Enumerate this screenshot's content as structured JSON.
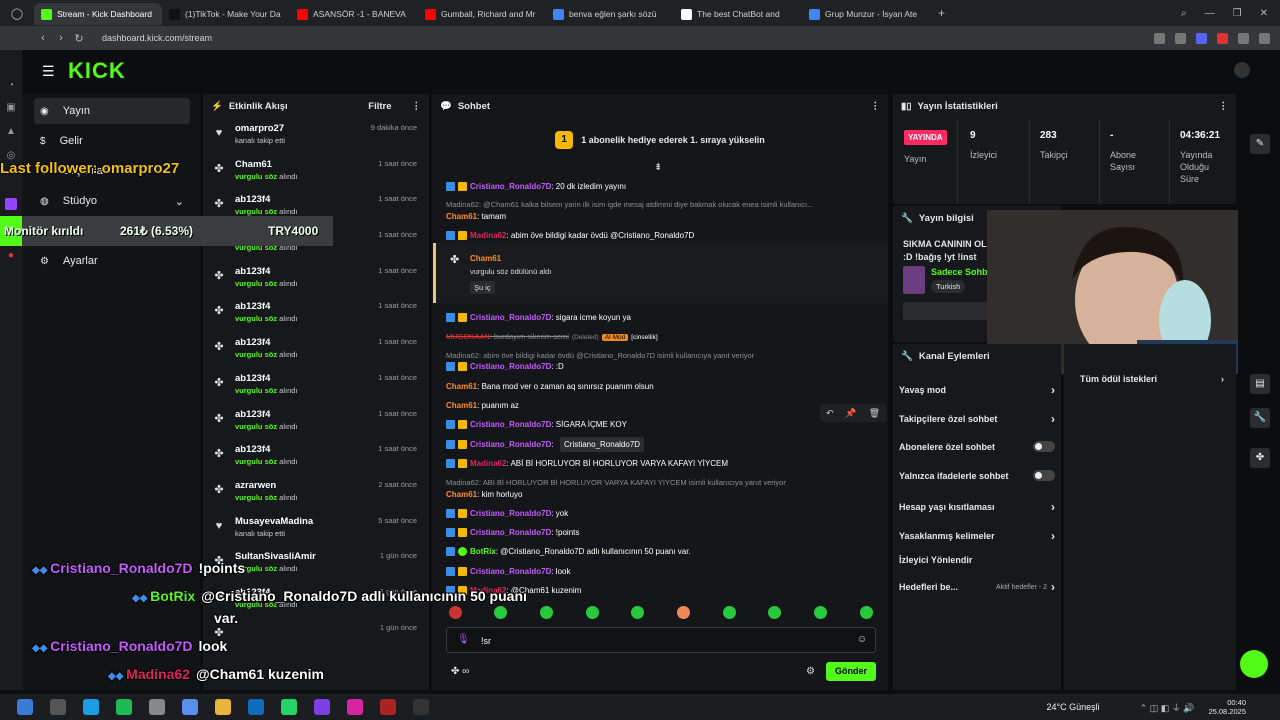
{
  "browser": {
    "tabs": [
      {
        "label": "Stream - Kick Dashboard",
        "color": "#53fc18"
      },
      {
        "label": "(1)TikTok - Make Your Da",
        "color": "#111111"
      },
      {
        "label": "ASANSÖR -1 - BANEVA",
        "color": "#ff0000"
      },
      {
        "label": "Gumball, Richard and Mr",
        "color": "#ff0000"
      },
      {
        "label": "benva eğlen şarkı sözü",
        "color": "#4285f4"
      },
      {
        "label": "The best ChatBot and",
        "color": "#ffffff"
      },
      {
        "label": "Grup Munzur - İsyan Ate",
        "color": "#4285f4"
      }
    ],
    "url": "dashboard.kick.com/stream"
  },
  "logo": "KICK",
  "sidenav": {
    "items": [
      {
        "label": "Yayın",
        "icon": "broadcast-icon"
      },
      {
        "label": "Gelir",
        "icon": "revenue-icon"
      },
      {
        "label": "Başarılar",
        "icon": "trophy-icon"
      },
      {
        "label": "Stüdyo",
        "icon": "studio-icon"
      },
      {
        "label": "Kanal",
        "icon": "channel-icon"
      },
      {
        "label": "Ayarlar",
        "icon": "settings-icon"
      }
    ]
  },
  "activity": {
    "title": "Etkinlik Akışı",
    "filter": "Filtre",
    "items": [
      {
        "name": "omarpro27",
        "sub": "kanalı takip etti",
        "time": "9 dakika önce",
        "icon": "heart-icon"
      },
      {
        "name": "Cham61",
        "sub": "vurgulu söz alındı",
        "time": "1 saat önce",
        "icon": "points-icon"
      },
      {
        "name": "ab123f4",
        "sub": "vurgulu söz alındı",
        "time": "1 saat önce",
        "icon": "points-icon"
      },
      {
        "name": "ab123f4",
        "sub": "vurgulu söz alındı",
        "time": "1 saat önce",
        "icon": "points-icon"
      },
      {
        "name": "ab123f4",
        "sub": "vurgulu söz alındı",
        "time": "1 saat önce",
        "icon": "points-icon"
      },
      {
        "name": "ab123f4",
        "sub": "vurgulu söz alındı",
        "time": "1 saat önce",
        "icon": "points-icon"
      },
      {
        "name": "ab123f4",
        "sub": "vurgulu söz alındı",
        "time": "1 saat önce",
        "icon": "points-icon"
      },
      {
        "name": "ab123f4",
        "sub": "vurgulu söz alındı",
        "time": "1 saat önce",
        "icon": "points-icon"
      },
      {
        "name": "ab123f4",
        "sub": "vurgulu söz alındı",
        "time": "1 saat önce",
        "icon": "points-icon"
      },
      {
        "name": "ab123f4",
        "sub": "vurgulu söz alındı",
        "time": "1 saat önce",
        "icon": "points-icon"
      },
      {
        "name": "azrarwen",
        "sub": "vurgulu söz alındı",
        "time": "2 saat önce",
        "icon": "points-icon"
      },
      {
        "name": "MusayevaMadina",
        "sub": "kanalı takip etti",
        "time": "5 saat önce",
        "icon": "heart-icon"
      },
      {
        "name": "SultanSivasliAmir",
        "sub": "vurgulu söz alındı",
        "time": "1 gün önce",
        "icon": "points-icon"
      },
      {
        "name": "ab123f4",
        "sub": "vurgulu söz alındı",
        "time": "1 gün önce",
        "icon": "points-icon"
      },
      {
        "name": "",
        "sub": "",
        "time": "1 gün önce",
        "icon": "points-icon"
      }
    ]
  },
  "chat": {
    "title": "Sohbet",
    "banner": "1 abonelik hediye ederek 1. sıraya yükselin",
    "banner_num": "1",
    "messages": [
      {
        "kind": "msg",
        "user": "Cristiano_Ronaldo7D",
        "color": "#c65cff",
        "badges": 2,
        "text": ": 20 dk izledim yayını"
      },
      {
        "kind": "reply",
        "text": "Madina62: @Cham61 kalka bilsem yarin ilk isim igde mesaj atdimmi diye bakmak olucak enea isimli kullanıcı..."
      },
      {
        "kind": "msg",
        "user": "Cham61",
        "color": "#ff8c2a",
        "badges": 0,
        "text": ": tamam"
      },
      {
        "kind": "msg",
        "user": "Madina62",
        "color": "#e0245e",
        "badges": 2,
        "text": ": abim öve bildigi kadar övdü @Cristiano_Ronaldo7D"
      },
      {
        "kind": "msg",
        "user": "Cristiano_Ronaldo7D",
        "color": "#c65cff",
        "badges": 2,
        "text": ": sigara icme koyun ya"
      },
      {
        "kind": "deleted",
        "user": "MUGOKAAN",
        "text": ": burdayım sikerim semi",
        "tag1": "(Deleted)",
        "tag2": "AI Mod",
        "tag3": "[cinsellik]"
      },
      {
        "kind": "reply",
        "text": "Madina62: abim öve bildigi kadar övdü @Cristiano_Ronaldo7D isimli kullanıcıya yanıt veriyor"
      },
      {
        "kind": "msg",
        "user": "Cristiano_Ronaldo7D",
        "color": "#c65cff",
        "badges": 2,
        "text": ": :D"
      },
      {
        "kind": "msg",
        "user": "Cham61",
        "color": "#ff8c2a",
        "badges": 0,
        "text": ": Bana mod ver o zaman aq sınırsız puanım olsun"
      },
      {
        "kind": "msg",
        "user": "Cham61",
        "color": "#ff8c2a",
        "badges": 0,
        "text": ": puanım az"
      },
      {
        "kind": "msg",
        "user": "Cristiano_Ronaldo7D",
        "color": "#c65cff",
        "badges": 2,
        "text": ": SİGARA İÇME KOY"
      },
      {
        "kind": "msg",
        "user": "Cristiano_Ronaldo7D",
        "color": "#c65cff",
        "badges": 2,
        "text": ": "
      },
      {
        "kind": "msg",
        "user": "Madina62",
        "color": "#e0245e",
        "badges": 2,
        "text": ": ABİ Bİ HORLUYOR Bİ HORLUYOR VARYA KAFAYI YİYCEM"
      },
      {
        "kind": "reply",
        "text": "Madina62: ABİ Bİ HORLUYOR Bİ HORLUYOR VARYA KAFAYI YİYCEM isimli kullanıcıya yanıt veriyor"
      },
      {
        "kind": "msg",
        "user": "Cham61",
        "color": "#ff8c2a",
        "badges": 0,
        "text": ": kim horluyo"
      },
      {
        "kind": "msg",
        "user": "Cristiano_Ronaldo7D",
        "color": "#c65cff",
        "badges": 2,
        "text": ": yok"
      },
      {
        "kind": "msg",
        "user": "Cristiano_Ronaldo7D",
        "color": "#c65cff",
        "badges": 2,
        "text": ": !points"
      },
      {
        "kind": "msg",
        "user": "BotRix",
        "color": "#53fc18",
        "badges": 3,
        "text": ": @Cristiano_Ronaldo7D adlı kullanıcının 50 puanı var."
      },
      {
        "kind": "msg",
        "user": "Cristiano_Ronaldo7D",
        "color": "#c65cff",
        "badges": 2,
        "text": ": look"
      },
      {
        "kind": "msg",
        "user": "Madina62",
        "color": "#e0245e",
        "badges": 2,
        "text": ": @Cham61 kuzenim"
      }
    ],
    "highlight": {
      "user": "Cham61",
      "text": "vurgulu söz ödülünü aldı",
      "reward": "Şu iç"
    },
    "tooltip": "Cristiano_Ronaldo7D",
    "input_value": "!sr",
    "send": "Gönder"
  },
  "stats": {
    "title": "Yayın İstatistikleri",
    "live_label": "YAYINDA",
    "status_label": "Yayın",
    "viewers": "9",
    "viewers_label": "İzleyici",
    "followers": "283",
    "followers_label": "Takipçi",
    "subs": "-",
    "subs_label": "Abone Sayısı",
    "uptime": "04:36:21",
    "uptime_label": "Yayında Olduğu Süre"
  },
  "stream_info": {
    "title": "Yayın bilgisi",
    "stream_title": "SIKMA CANININ OL // :D !bağış !yt !inst",
    "category": "Sadece Sohb",
    "language": "Turkish"
  },
  "rewards_link": "Tüm ödül istekleri",
  "channel_actions": {
    "title": "Kanal Eylemleri",
    "items": [
      {
        "label": "Yavaş mod",
        "control": "arrow"
      },
      {
        "label": "Takipçilere özel sohbet",
        "control": "arrow"
      },
      {
        "label": "Abonelere özel sohbet",
        "control": "toggle"
      },
      {
        "label": "Yalnızca ifadelerle sohbet",
        "control": "toggle"
      },
      {
        "label": "Hesap yaşı kısıtlaması",
        "control": "arrow"
      },
      {
        "label": "Yasaklanmış kelimeler",
        "control": "arrow"
      },
      {
        "label": "İzleyici Yönlendir",
        "control": "none"
      },
      {
        "label": "Hedefleri be...",
        "control": "arrow",
        "extra": "Aktif hedefler - 2"
      }
    ]
  },
  "overlay": {
    "last_follower": "Last follower: omarpro27",
    "goal_label": "Monitör kırıldı",
    "goal_progress": "261₺ (6.53%)",
    "goal_fraction": 0.0653,
    "goal_target": "TRY4000",
    "chat": [
      {
        "user": "Cristiano_Ronaldo7D",
        "text": "!points",
        "color": "#c65cff"
      },
      {
        "user": "BotRix",
        "text": "@Cristiano_Ronaldo7D adlı kullanıcının 50 puanı",
        "text2": "var.",
        "color": "#53fc18"
      },
      {
        "user": "Cristiano_Ronaldo7D",
        "text": "look",
        "color": "#c65cff"
      },
      {
        "user": "Madina62",
        "text": "@Cham61 kuzenim",
        "color": "#e0245e"
      }
    ]
  },
  "taskbar": {
    "weather": "24°C  Güneşli",
    "time": "00:40",
    "date": "25.08.2025"
  },
  "colors": {
    "accent": "#53fc18",
    "live": "#ff2a5f"
  }
}
